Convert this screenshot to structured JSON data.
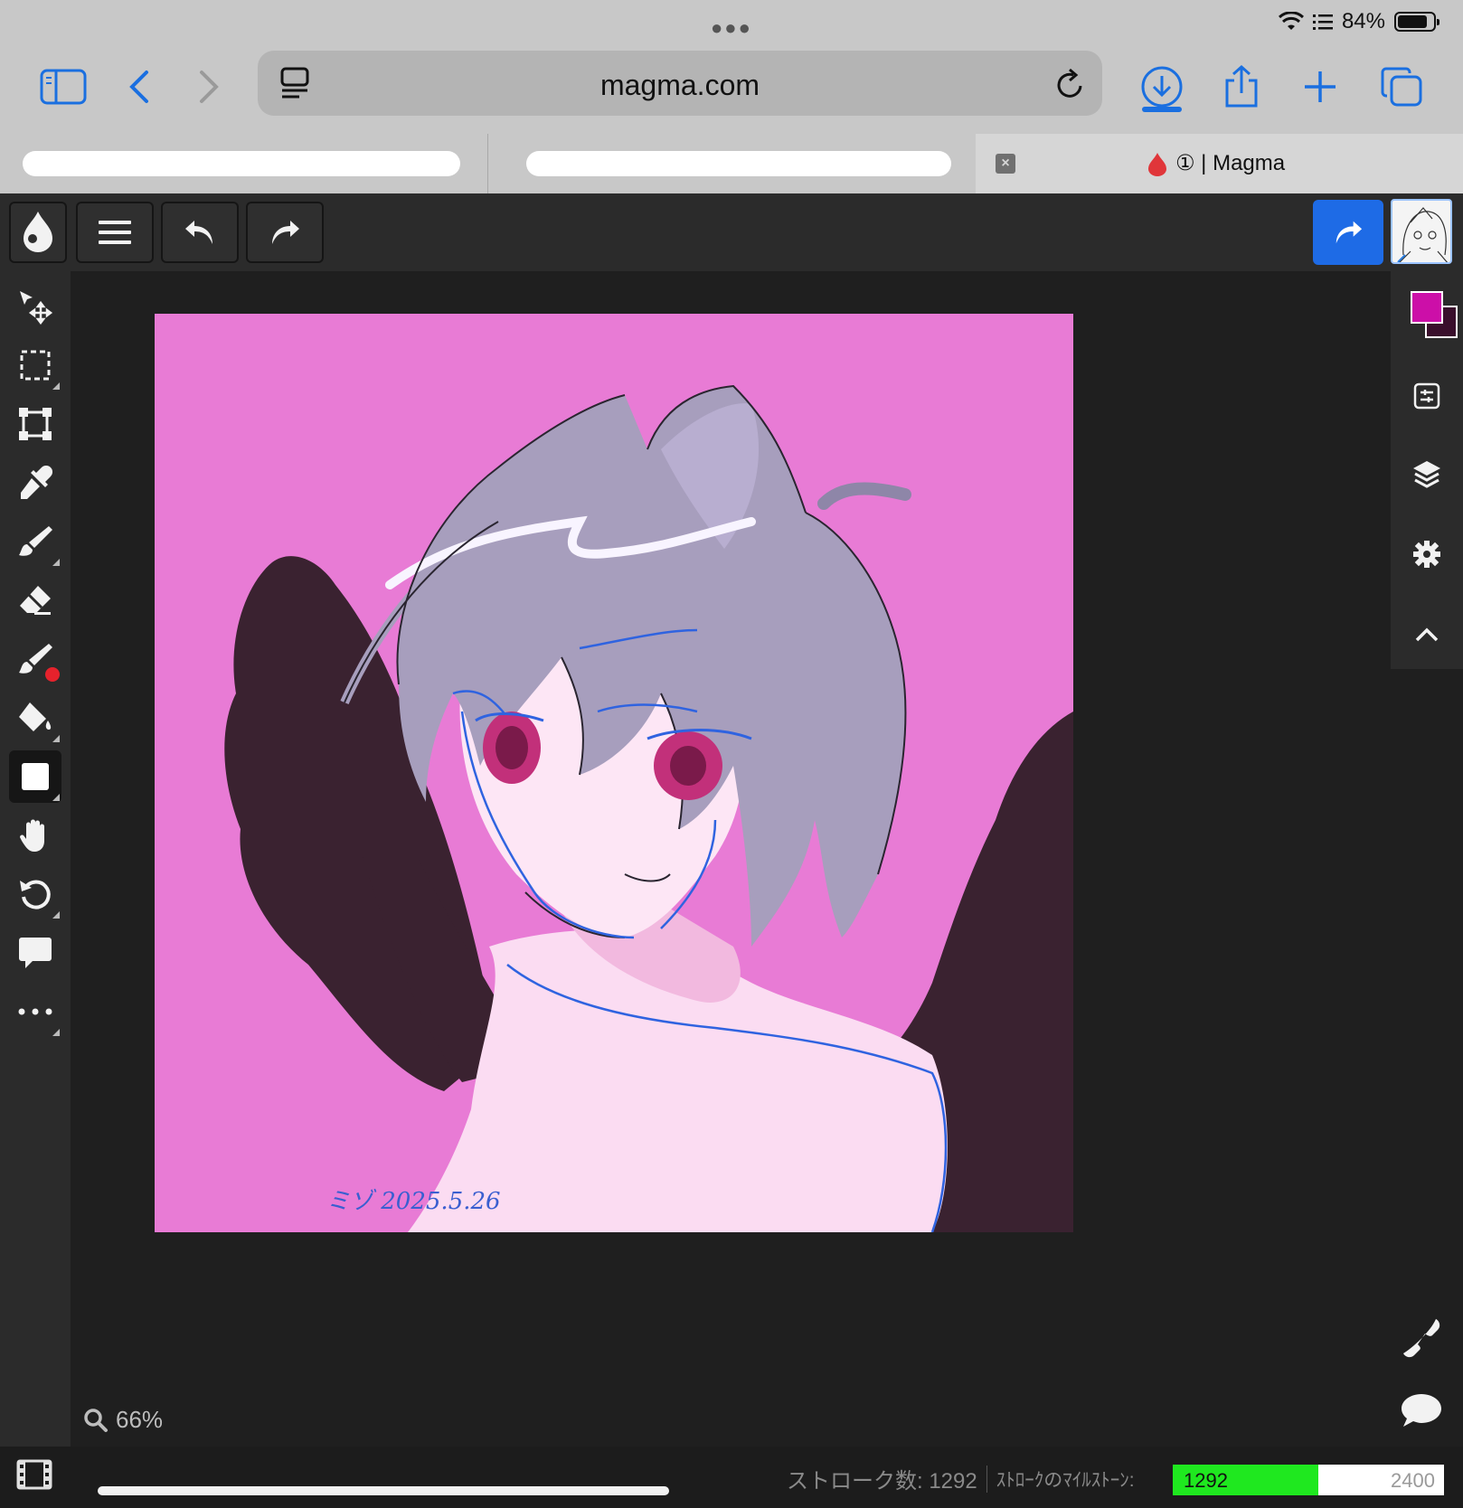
{
  "status": {
    "battery": "84%",
    "battery_level": 0.84
  },
  "browser": {
    "url": "magma.com",
    "active_tab_title": "① | Magma"
  },
  "canvas": {
    "bg_color": "#e87bd5",
    "signature": "ミゾ 2025.5.26"
  },
  "colors": {
    "foreground": "#cc0fa8",
    "background": "#3a0f2c"
  },
  "zoom": "66%",
  "strokes": {
    "count_label": "ストローク数: 1292",
    "milestone_label": "ｽﾄﾛｰｸのﾏｲﾙｽﾄｰﾝ:",
    "current": "1292",
    "target": "2400",
    "progress": 0.5383
  },
  "icons": {
    "left_tools": [
      "move-icon",
      "selection-icon",
      "transform-icon",
      "eyedropper-icon",
      "brush-icon",
      "eraser-icon",
      "smudge-icon",
      "fill-bucket-icon",
      "shape-icon",
      "hand-icon",
      "rotate-icon",
      "comment-icon",
      "more-icon"
    ],
    "right_panel": [
      "adjustments-icon",
      "layers-icon",
      "settings-icon",
      "collapse-icon"
    ]
  }
}
